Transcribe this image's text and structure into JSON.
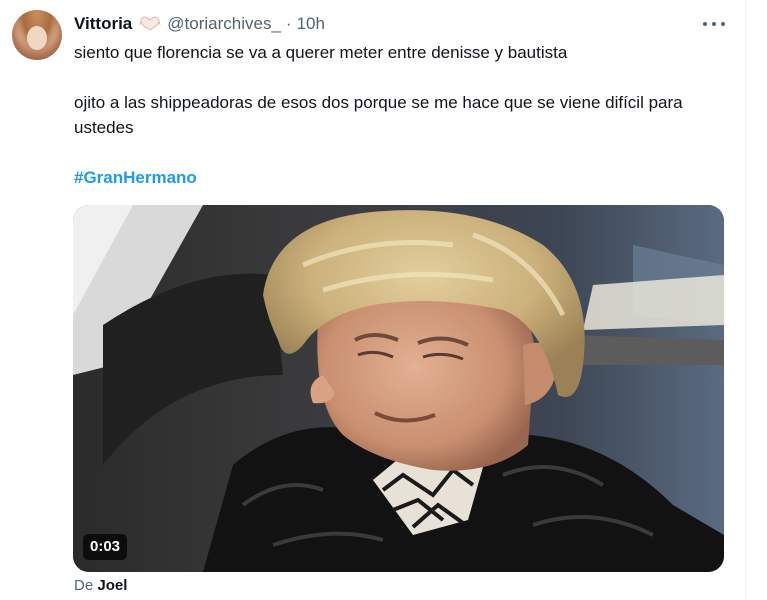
{
  "author": {
    "display_name": "Vittoria",
    "handle": "@toriarchives_",
    "separator": "·",
    "time": "10h",
    "badge_icon": "heart-hands-icon",
    "avatar": "avatar-image"
  },
  "tweet": {
    "lines": [
      "siento que florencia se va a querer meter entre denisse y bautista",
      "ojito a las shippeadoras de esos dos porque se me hace que se viene difícil para ustedes"
    ],
    "hashtag": "#GranHermano"
  },
  "media": {
    "type": "video",
    "duration": "0:03"
  },
  "source": {
    "prefix": "De",
    "name": "Joel"
  },
  "menu": {
    "icon": "more-horizontal-icon"
  },
  "colors": {
    "accent": "#1d9bf0",
    "text": "#0f1419",
    "secondary": "#536471"
  }
}
